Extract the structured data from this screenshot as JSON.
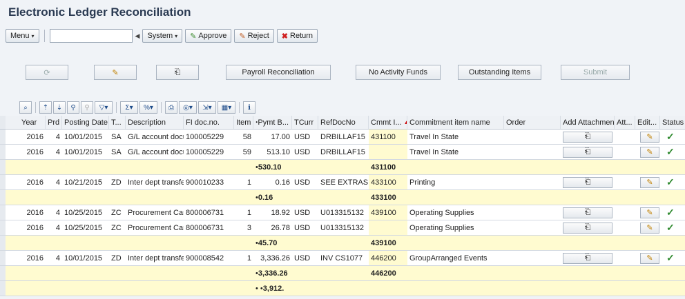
{
  "title": "Electronic Ledger Reconciliation",
  "toolbar": {
    "menu": "Menu",
    "system": "System",
    "approve": "Approve",
    "reject": "Reject",
    "return": "Return"
  },
  "actions": {
    "payroll": "Payroll Reconciliation",
    "no_activity": "No Activity Funds",
    "outstanding": "Outstanding Items",
    "submit": "Submit"
  },
  "columns": {
    "year": "Year",
    "prd": "Prd",
    "posting_date": "Posting Date",
    "t": "T...",
    "description": "Description",
    "fi_doc": "FI doc.no.",
    "item": "Item",
    "pymt": "Pymt B...",
    "tcurr": "TCurr",
    "refdoc": "RefDocNo",
    "cmmt": "Cmmt I...",
    "commit_name": "Commitment item name",
    "order": "Order",
    "add_attach": "Add Attachment",
    "att": "Att...",
    "edit": "Edit...",
    "status": "Status"
  },
  "rows": [
    {
      "year": "2016",
      "prd": "4",
      "date": "10/01/2015",
      "t": "SA",
      "desc": "G/L account docu",
      "fidoc": "100005229",
      "item": "58",
      "pymt": "17.00",
      "curr": "USD",
      "ref": "DRBILLAF15",
      "cmmt": "431100",
      "name": "Travel In State"
    },
    {
      "year": "2016",
      "prd": "4",
      "date": "10/01/2015",
      "t": "SA",
      "desc": "G/L account docu",
      "fidoc": "100005229",
      "item": "59",
      "pymt": "513.10",
      "curr": "USD",
      "ref": "DRBILLAF15",
      "cmmt": "",
      "name": "Travel In State"
    },
    {
      "sum": "530.10",
      "cmmt": "431100"
    },
    {
      "year": "2016",
      "prd": "4",
      "date": "10/21/2015",
      "t": "ZD",
      "desc": "Inter dept transfer",
      "fidoc": "900010233",
      "item": "1",
      "pymt": "0.16",
      "curr": "USD",
      "ref": "SEE EXTRAS",
      "cmmt": "433100",
      "name": "Printing"
    },
    {
      "sum": "0.16",
      "cmmt": "433100"
    },
    {
      "year": "2016",
      "prd": "4",
      "date": "10/25/2015",
      "t": "ZC",
      "desc": "Procurement Card",
      "fidoc": "800006731",
      "item": "1",
      "pymt": "18.92",
      "curr": "USD",
      "ref": "U013315132",
      "cmmt": "439100",
      "name": "Operating Supplies"
    },
    {
      "year": "2016",
      "prd": "4",
      "date": "10/25/2015",
      "t": "ZC",
      "desc": "Procurement Card",
      "fidoc": "800006731",
      "item": "3",
      "pymt": "26.78",
      "curr": "USD",
      "ref": "U013315132",
      "cmmt": "",
      "name": "Operating Supplies"
    },
    {
      "sum": "45.70",
      "cmmt": "439100"
    },
    {
      "year": "2016",
      "prd": "4",
      "date": "10/01/2015",
      "t": "ZD",
      "desc": "Inter dept transfer",
      "fidoc": "900008542",
      "item": "1",
      "pymt": "3,336.26",
      "curr": "USD",
      "ref": "INV CS1077",
      "cmmt": "446200",
      "name": "GroupArranged Events"
    },
    {
      "sum": "3,336.26",
      "cmmt": "446200"
    },
    {
      "sum": "3,912.",
      "cmmt": "",
      "double": true
    }
  ]
}
